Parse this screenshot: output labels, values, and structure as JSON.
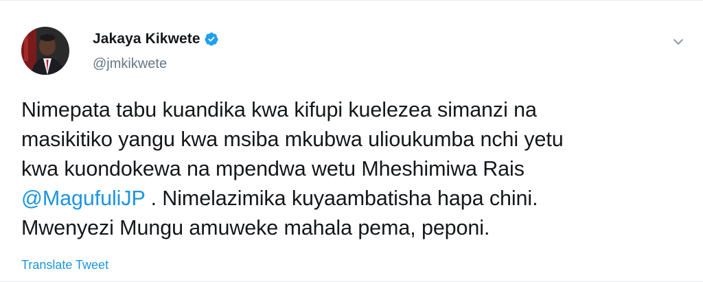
{
  "author": {
    "display_name": "Jakaya Kikwete",
    "handle": "@jmkikwete",
    "verified": true,
    "avatar_icon": "profile-photo-avatar",
    "verified_icon": "verified-badge-icon"
  },
  "tweet": {
    "line1": "Nimepata tabu kuandika kwa kifupi kuelezea simanzi na",
    "line2": "masikitiko yangu kwa msiba mkubwa ulioukumba nchi yetu",
    "line3": "kwa kuondokewa na mpendwa wetu Mheshimiwa Rais",
    "mention": "@MagufuliJP",
    "line4_rest": ". Nimelazimika kuyaambatisha hapa chini.",
    "line5": "Mwenyezi Mungu amuweke mahala pema, peponi."
  },
  "actions": {
    "translate_label": "Translate Tweet",
    "more_icon": "chevron-down-icon"
  },
  "colors": {
    "text": "#14171a",
    "secondary": "#657786",
    "link": "#1b95e0",
    "verified": "#1da1f2"
  }
}
